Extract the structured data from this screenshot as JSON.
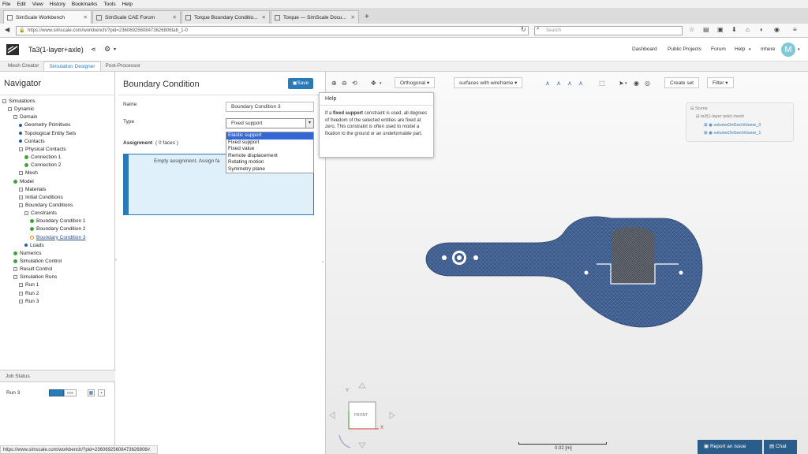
{
  "browser": {
    "menu": [
      "File",
      "Edit",
      "View",
      "History",
      "Bookmarks",
      "Tools",
      "Help"
    ],
    "tabs": [
      {
        "label": "SimScale Workbench",
        "active": true
      },
      {
        "label": "SimScale CAE Forum",
        "active": false
      },
      {
        "label": "Torque Boundary Conditio...",
        "active": false
      },
      {
        "label": "Torque — SimScale Docu...",
        "active": false
      }
    ],
    "url": "https://www.simscale.com/workbench/?pid=23606925608473626806tab_1-0",
    "search_placeholder": "Search",
    "status_url": "https://www.simscale.com/workbench/?pid=23606925608473626806#"
  },
  "app": {
    "project_title": "Ta3(1-layer+axle)",
    "top_links": [
      "Dashboard",
      "Public Projects",
      "Forum",
      "Help"
    ],
    "user": "mhere",
    "avatar_letter": "M",
    "tabs": [
      "Mesh Creator",
      "Simulation Designer",
      "Post-Processor"
    ],
    "active_tab": "Simulation Designer"
  },
  "navigator": {
    "title": "Navigator",
    "tree": [
      {
        "label": "Simulations",
        "icon": "toggle",
        "depth": 0
      },
      {
        "label": "Dynamic",
        "icon": "toggle",
        "depth": 1
      },
      {
        "label": "Domain",
        "icon": "toggle",
        "depth": 2
      },
      {
        "label": "Geometry Primitives",
        "icon": "dot",
        "depth": 3
      },
      {
        "label": "Topological Entity Sets",
        "icon": "dot",
        "depth": 3
      },
      {
        "label": "Contacts",
        "icon": "dot",
        "depth": 3
      },
      {
        "label": "Physical Contacts",
        "icon": "toggle",
        "depth": 3
      },
      {
        "label": "Connection 1",
        "icon": "ok",
        "depth": 4
      },
      {
        "label": "Connection 2",
        "icon": "ok",
        "depth": 4
      },
      {
        "label": "Mesh",
        "icon": "toggle",
        "depth": 3
      },
      {
        "label": "Model",
        "icon": "ok",
        "depth": 2
      },
      {
        "label": "Materials",
        "icon": "toggle",
        "depth": 3
      },
      {
        "label": "Initial Conditions",
        "icon": "toggle",
        "depth": 3
      },
      {
        "label": "Boundary Conditions",
        "icon": "toggle",
        "depth": 3
      },
      {
        "label": "Constraints",
        "icon": "toggle",
        "depth": 4
      },
      {
        "label": "Boundary Condition 1",
        "icon": "ok",
        "depth": 5
      },
      {
        "label": "Boundary Condition 2",
        "icon": "ok",
        "depth": 5
      },
      {
        "label": "Boundary Condition 3",
        "icon": "warn",
        "depth": 5,
        "selected": true
      },
      {
        "label": "Loads",
        "icon": "dot",
        "depth": 4
      },
      {
        "label": "Numerics",
        "icon": "ok",
        "depth": 2
      },
      {
        "label": "Simulation Control",
        "icon": "ok",
        "depth": 2
      },
      {
        "label": "Result Control",
        "icon": "toggle",
        "depth": 2
      },
      {
        "label": "Simulation Runs",
        "icon": "toggle",
        "depth": 2
      },
      {
        "label": "Run 1",
        "icon": "toggle",
        "depth": 3
      },
      {
        "label": "Run 2",
        "icon": "toggle",
        "depth": 3
      },
      {
        "label": "Run 3",
        "icon": "toggle",
        "depth": 3
      }
    ]
  },
  "job_status": {
    "title": "Job Status",
    "run_label": "Run 3",
    "badge": "",
    "badge_right": "one"
  },
  "boundary_condition": {
    "title": "Boundary Condition",
    "save_label": "Save",
    "name_label": "Name",
    "name_value": "Boundary Condition 3",
    "type_label": "Type",
    "type_value": "Fixed support",
    "type_options": [
      "Elastic support",
      "Fixed support",
      "Fixed value",
      "Remote displacement",
      "Rotating motion",
      "Symmetry plane"
    ],
    "highlighted_option": "Elastic support",
    "assignment_label": "Assignment",
    "assignment_count": "( 0 faces )",
    "assignment_text": "Empty assignment. Assign fa"
  },
  "help_popup": {
    "title": "Help",
    "text_prefix": "If a ",
    "text_bold": "fixed support",
    "text_rest": " constraint is used, all degrees of freedom of the selected entities are fixed at zero. This constraint is often used to model a fixation to the ground or an undeformable part."
  },
  "viewport": {
    "projection": "Orthogonal",
    "render_mode": "surfaces with wireframe",
    "create_set": "Create set",
    "filter": "Filter",
    "scene_root": "Scene",
    "scene_mesh": "ta3(1-layer axle) mesh",
    "scene_items": [
      "volumeOnGeoVolume_0",
      "volumeOnGeoVolume_1"
    ],
    "cube_label": "FRONT",
    "axis_x": "X",
    "axis_y": "Y",
    "scale_label": "0.02 [m]"
  },
  "footer": {
    "report": "Report an issue",
    "chat": "Chat"
  },
  "colors": {
    "accent": "#2a7ab8",
    "mesh_blue": "#3b5a8c",
    "ok_green": "#3aa635",
    "selection_fill": "#dff0fb"
  }
}
